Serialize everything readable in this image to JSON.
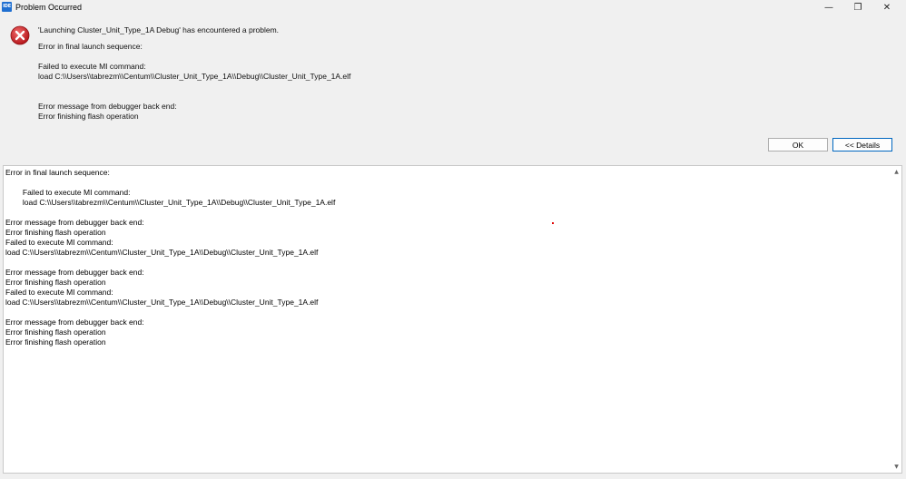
{
  "window": {
    "icon_text": "IDE",
    "title": "Problem Occurred",
    "minimize_glyph": "—",
    "maximize_glyph": "❐",
    "close_glyph": "✕"
  },
  "message": {
    "headline": "'Launching Cluster_Unit_Type_1A Debug' has encountered a problem.",
    "line1": "Error in final launch sequence:",
    "line2": "Failed to execute MI command:",
    "line3": "load C:\\\\Users\\\\tabrezm\\\\Centum\\\\Cluster_Unit_Type_1A\\\\Debug\\\\Cluster_Unit_Type_1A.elf",
    "line4": "Error message from debugger back end:",
    "line5": "Error finishing flash operation"
  },
  "buttons": {
    "ok": "OK",
    "details": "<< Details"
  },
  "details_lines": [
    "Error in final launch sequence:",
    "",
    "        Failed to execute MI command:",
    "        load C:\\\\Users\\\\tabrezm\\\\Centum\\\\Cluster_Unit_Type_1A\\\\Debug\\\\Cluster_Unit_Type_1A.elf",
    "",
    "Error message from debugger back end:",
    "Error finishing flash operation",
    "Failed to execute MI command:",
    "load C:\\\\Users\\\\tabrezm\\\\Centum\\\\Cluster_Unit_Type_1A\\\\Debug\\\\Cluster_Unit_Type_1A.elf",
    "",
    "Error message from debugger back end:",
    "Error finishing flash operation",
    "Failed to execute MI command:",
    "load C:\\\\Users\\\\tabrezm\\\\Centum\\\\Cluster_Unit_Type_1A\\\\Debug\\\\Cluster_Unit_Type_1A.elf",
    "",
    "Error message from debugger back end:",
    "Error finishing flash operation",
    "Error finishing flash operation"
  ],
  "icons": {
    "app": "ide-icon",
    "error": "error-icon",
    "scroll_up": "scroll-up-icon",
    "scroll_down": "scroll-down-icon"
  },
  "colors": {
    "error_red": "#d9262b",
    "accent_blue": "#0067c0"
  }
}
